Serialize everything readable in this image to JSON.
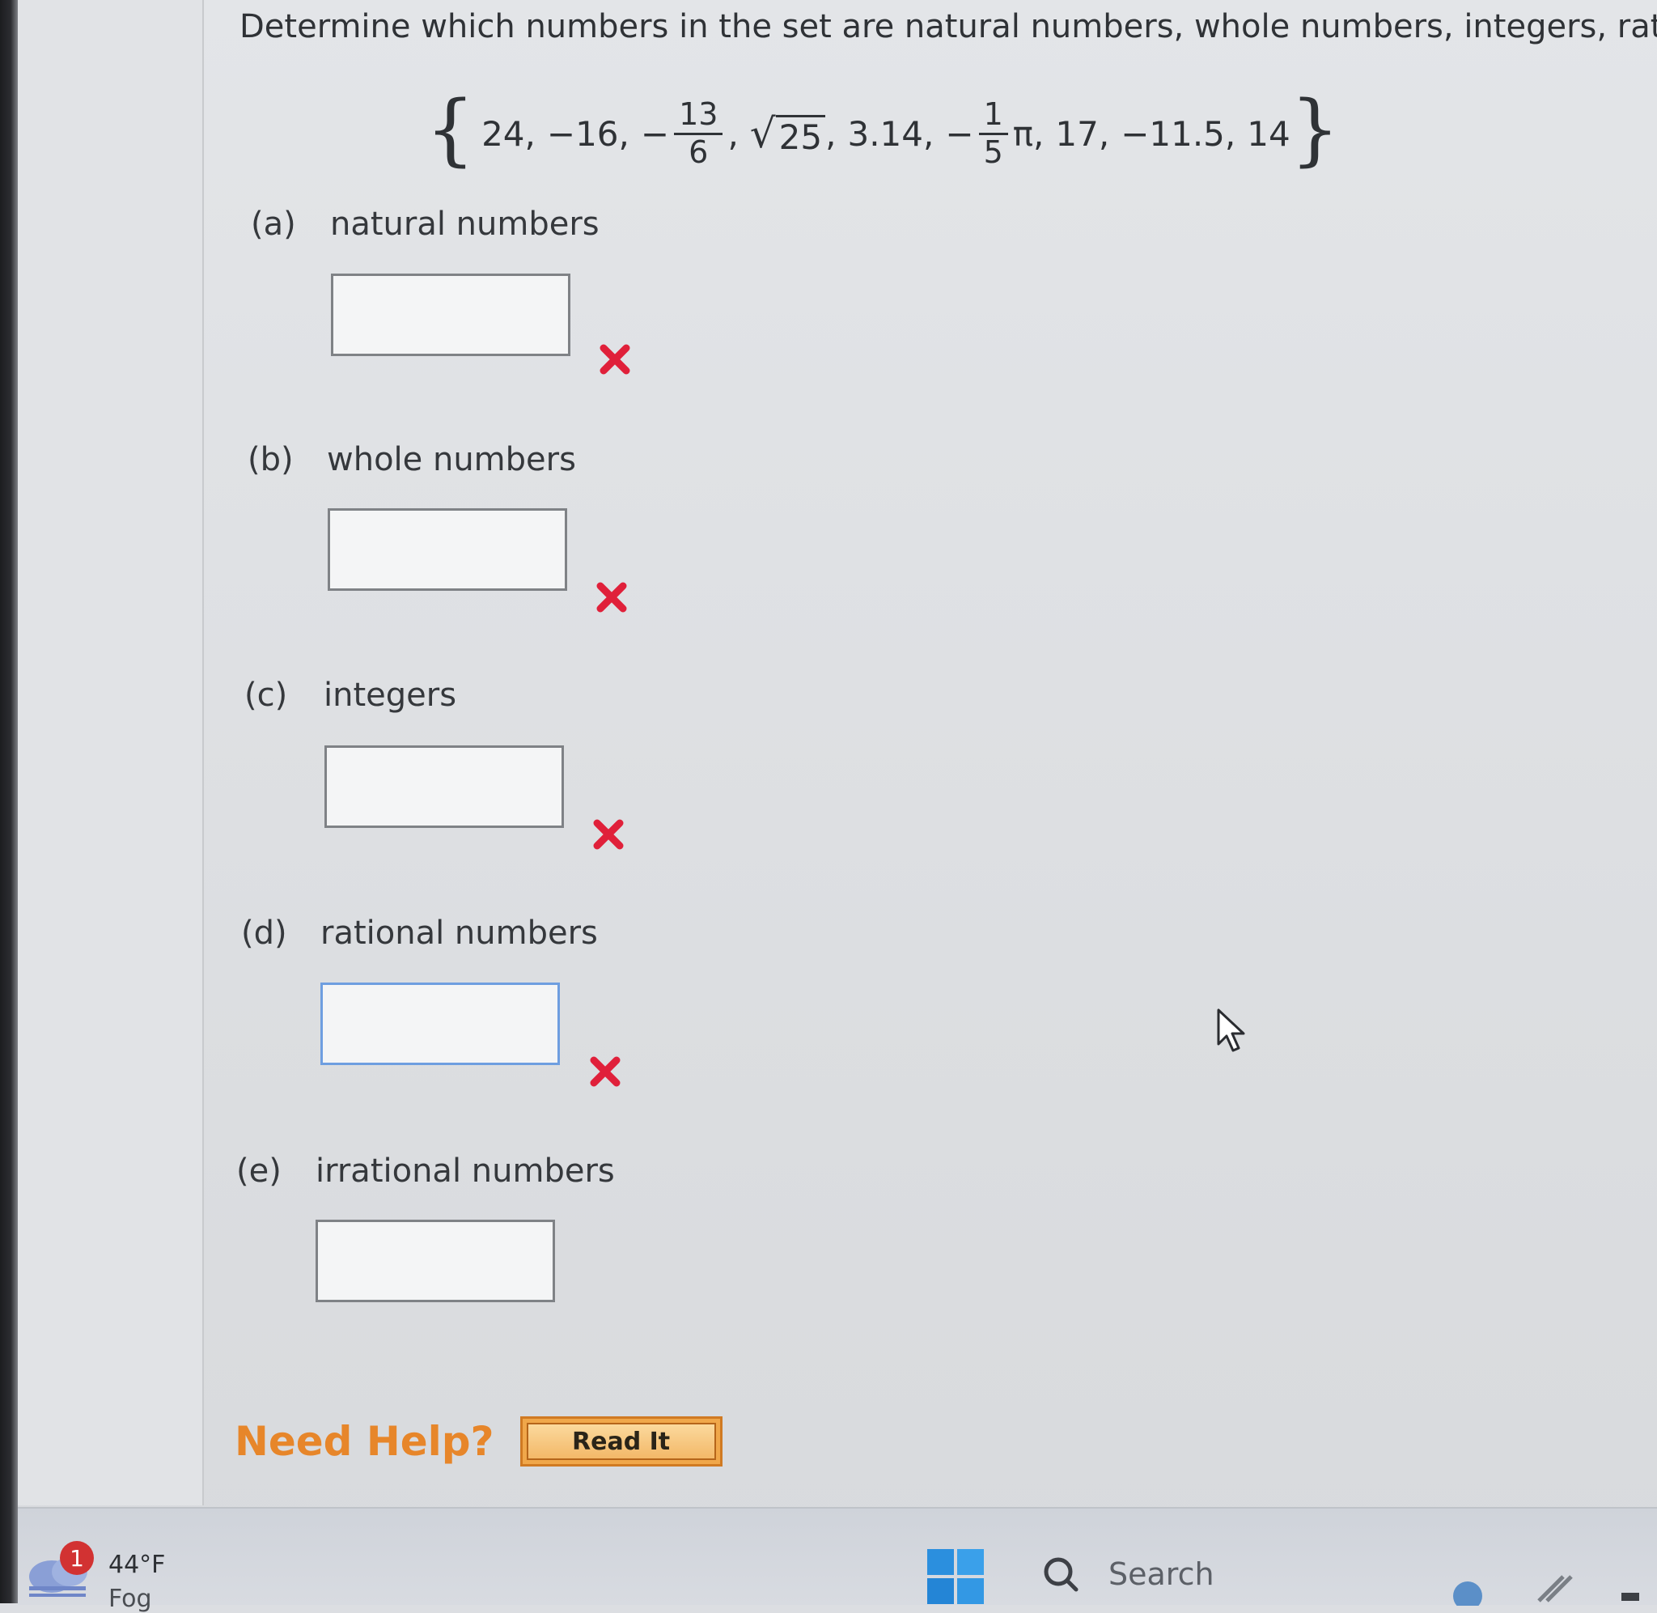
{
  "question": {
    "prompt": "Determine which numbers in the set are natural numbers, whole numbers, integers, rat",
    "set": {
      "open_brace": "{",
      "close_brace": "}",
      "items": {
        "a": "24,",
        "b": "−16,",
        "c_sign": "−",
        "c_num": "13",
        "c_den": "6",
        "c_sep": ",",
        "d_radical": "√",
        "d_radicand": "25",
        "d_sep": ",",
        "e": "3.14,",
        "f_sign": "−",
        "f_num": "1",
        "f_den": "5",
        "f_tail": "π,",
        "g": "17,",
        "h": "−11.5,",
        "i": "14"
      }
    }
  },
  "parts": [
    {
      "letter": "(a)",
      "label": "natural numbers",
      "value": "",
      "result": "incorrect"
    },
    {
      "letter": "(b)",
      "label": "whole numbers",
      "value": "",
      "result": "incorrect"
    },
    {
      "letter": "(c)",
      "label": "integers",
      "value": "",
      "result": "incorrect"
    },
    {
      "letter": "(d)",
      "label": "rational numbers",
      "value": "",
      "result": "incorrect",
      "focused": true
    },
    {
      "letter": "(e)",
      "label": "irrational numbers",
      "value": "",
      "result": "none"
    }
  ],
  "help": {
    "label": "Need Help?",
    "read_it": "Read It"
  },
  "taskbar": {
    "notification_count": "1",
    "temperature": "44°F",
    "condition": "Fog",
    "search_placeholder": "Search"
  },
  "colors": {
    "wrong_mark": "#e0203a",
    "help_text": "#e7862a",
    "read_button": "#f0a74a",
    "focused_border": "#6e9ee0"
  },
  "icons": {
    "wrong": "x-mark-icon",
    "cursor": "arrow-cursor-icon",
    "weather": "cloud-icon",
    "start": "windows-start-icon",
    "search": "search-icon"
  }
}
